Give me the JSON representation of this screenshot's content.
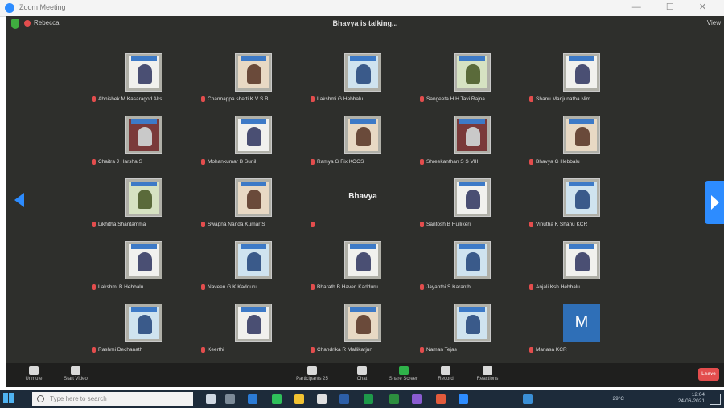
{
  "window": {
    "title": "Zoom Meeting"
  },
  "topbar": {
    "user": "Rebecca",
    "status": "Bhavya is talking...",
    "view": "View"
  },
  "participants": [
    {
      "name": "Abhishek M Kasaragod Aks",
      "photo": "id-photo"
    },
    {
      "name": "Channappa shetti K V S B",
      "photo": "id-photo"
    },
    {
      "name": "Lakshmi G Hebbalu",
      "photo": "id-photo"
    },
    {
      "name": "Sangeeta H H Tavi Rajna",
      "photo": "id-photo"
    },
    {
      "name": "Shanu Manjunatha Nim",
      "photo": "id-photo"
    },
    {
      "name": "Chaitra J Harsha S",
      "photo": "id-photo"
    },
    {
      "name": "Mohankumar B Sunil",
      "photo": "id-photo"
    },
    {
      "name": "Ramya G Fix KOOS",
      "photo": "id-photo"
    },
    {
      "name": "Shreekanthan S S VIII",
      "photo": "id-photo"
    },
    {
      "name": "Bhavya G Hebbalu",
      "photo": "id-photo"
    },
    {
      "name": "Likhitha Shantamma",
      "photo": "id-photo"
    },
    {
      "name": "Swapna Nanda Kumar S",
      "photo": "id-photo"
    },
    {
      "name": "Bhavya",
      "photo": "name-only"
    },
    {
      "name": "Santosh B Hullikeri",
      "photo": "id-photo"
    },
    {
      "name": "Vinutha K Shanu KCR",
      "photo": "id-photo"
    },
    {
      "name": "Lakshmi B Hebbalu",
      "photo": "id-photo"
    },
    {
      "name": "Naveen G K Kadduru",
      "photo": "id-photo"
    },
    {
      "name": "Bharath B Haveri Kadduru",
      "photo": "id-photo"
    },
    {
      "name": "Jayanthi S Karanth",
      "photo": "id-photo"
    },
    {
      "name": "Anjali Ksh Hebbalu",
      "photo": "id-photo"
    },
    {
      "name": "Rashmi Dechanath",
      "photo": "id-photo"
    },
    {
      "name": "Keerthi",
      "photo": "id-photo"
    },
    {
      "name": "Chandrika R Mallikarjun",
      "photo": "id-photo"
    },
    {
      "name": "Naman Tejas",
      "photo": "id-photo"
    },
    {
      "name": "Manasa KCR",
      "photo": "avatar",
      "avatar_letter": "M"
    }
  ],
  "toolbar": {
    "unmute": "Unmute",
    "start_video": "Start Video",
    "participants": "Participants",
    "participants_count": "25",
    "chat": "Chat",
    "share_screen": "Share Screen",
    "record": "Record",
    "reactions": "Reactions",
    "leave": "Leave"
  },
  "taskbar": {
    "search_placeholder": "Type here to search",
    "temperature": "29°C",
    "time": "12:04",
    "date": "24-06-2021"
  },
  "colors": {
    "accent": "#2d8cff",
    "meeting_bg": "#2e2f2c",
    "leave": "#e34d4d",
    "taskbar": "#1d2b3a"
  }
}
